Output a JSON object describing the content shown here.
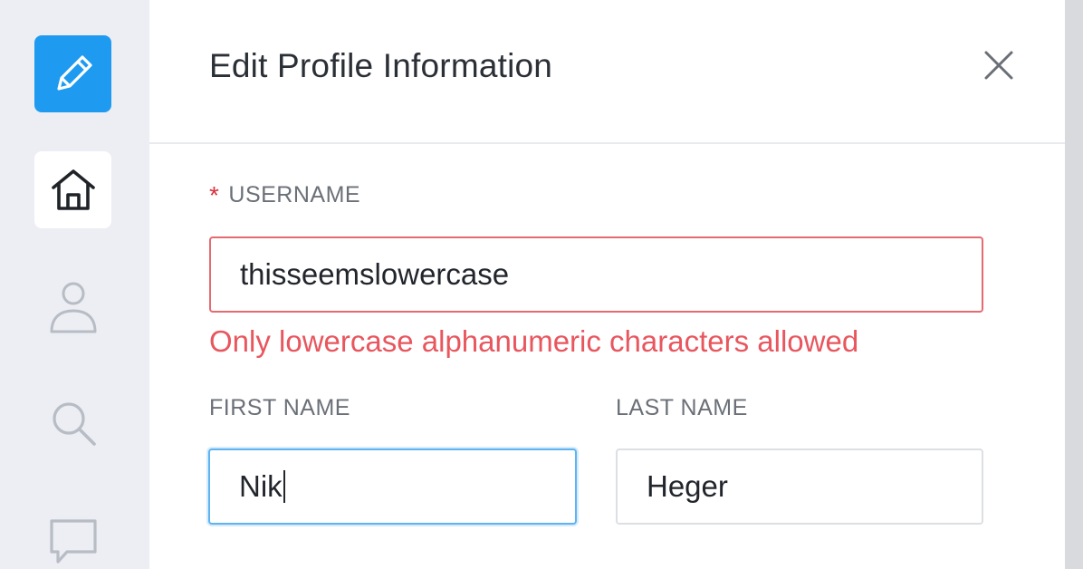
{
  "sidebar": {
    "items": [
      {
        "icon": "pencil-icon",
        "active": true
      },
      {
        "icon": "home-icon"
      },
      {
        "icon": "user-icon"
      },
      {
        "icon": "search-icon"
      },
      {
        "icon": "chat-bubble-icon"
      }
    ]
  },
  "dialog": {
    "title": "Edit Profile Information",
    "close_icon": "close-icon"
  },
  "form": {
    "username": {
      "required_mark": "*",
      "label": "USERNAME",
      "value": "thisseemslowercase",
      "error": "Only lowercase alphanumeric characters allowed"
    },
    "first_name": {
      "label": "FIRST NAME",
      "value": "Nik"
    },
    "last_name": {
      "label": "LAST NAME",
      "value": "Heger"
    }
  },
  "colors": {
    "accent": "#1e9bf0",
    "error": "#e8565e",
    "focus": "#5fb3f0"
  }
}
